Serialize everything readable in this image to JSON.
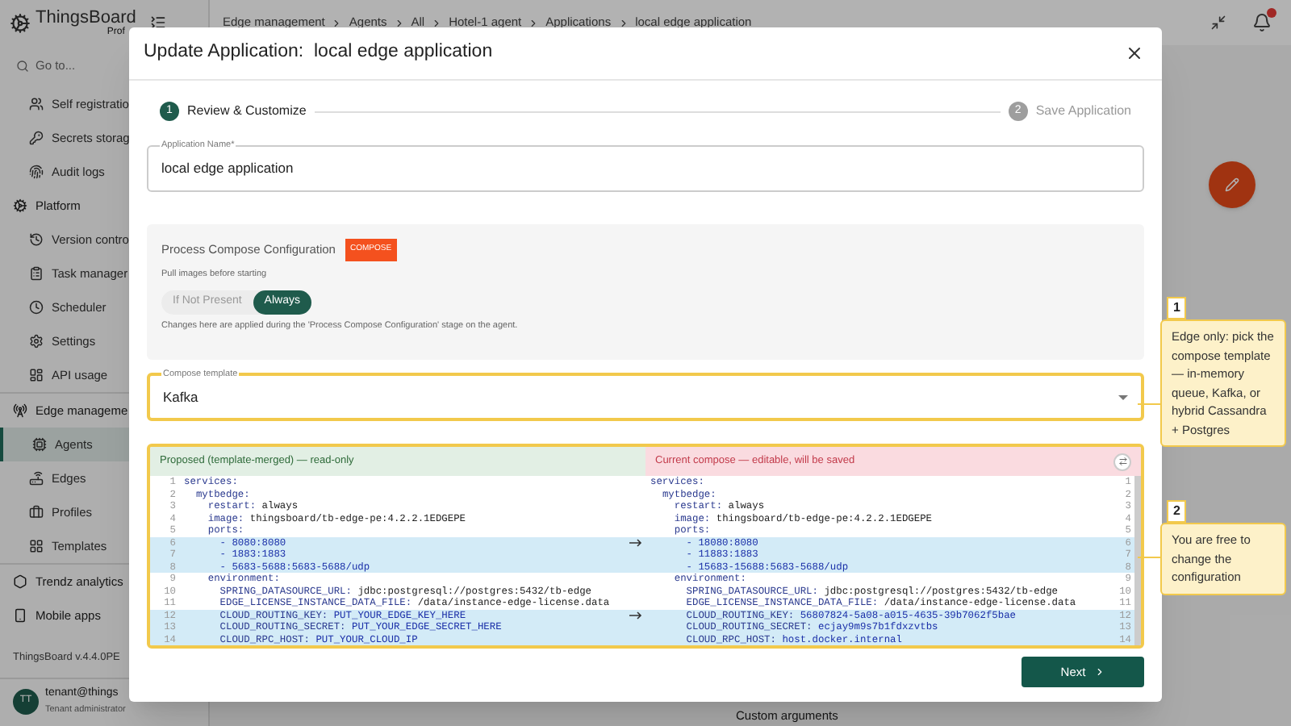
{
  "app": {
    "logo": "ThingsBoard",
    "logo_sub": "Prof",
    "search_placeholder": "Go to...",
    "breadcrumb": [
      "Edge management",
      "Agents",
      "All",
      "Hotel-1 agent",
      "Applications",
      "local edge application"
    ],
    "sidebar": {
      "items": [
        {
          "label": "Self registratio",
          "kind": "item",
          "selected": false
        },
        {
          "label": "Secrets storag",
          "kind": "item",
          "selected": false
        },
        {
          "label": "Audit logs",
          "kind": "item",
          "selected": false
        },
        {
          "label": "Platform",
          "kind": "section",
          "selected": false,
          "children": [
            {
              "label": "Version contro",
              "kind": "item",
              "selected": false
            },
            {
              "label": "Task manager",
              "kind": "item",
              "selected": false
            },
            {
              "label": "Scheduler",
              "kind": "item",
              "selected": false
            },
            {
              "label": "Settings",
              "kind": "item",
              "selected": false
            },
            {
              "label": "API usage",
              "kind": "item",
              "selected": false
            }
          ]
        },
        {
          "label": "Edge manageme",
          "kind": "section",
          "selected": false,
          "children": [
            {
              "label": "Agents",
              "kind": "item",
              "selected": true
            },
            {
              "label": "Edges",
              "kind": "item",
              "selected": false
            },
            {
              "label": "Profiles",
              "kind": "item",
              "selected": false
            },
            {
              "label": "Templates",
              "kind": "item",
              "selected": false
            }
          ]
        },
        {
          "label": "Trendz analytics",
          "kind": "section",
          "selected": false
        },
        {
          "label": "Mobile apps",
          "kind": "section",
          "selected": false
        }
      ]
    },
    "version": "ThingsBoard v.4.4.0PE",
    "user": {
      "initials": "TT",
      "email": "tenant@things",
      "role": "Tenant administrator"
    },
    "background_text": "Custom arguments"
  },
  "dialog": {
    "title": "Update Application:  local edge application",
    "steps": [
      {
        "number": "1",
        "label": "Review & Customize",
        "selected": true
      },
      {
        "number": "2",
        "label": "Save Application",
        "selected": false
      }
    ],
    "name_field": {
      "label": "Application Name*",
      "value": "local edge application"
    },
    "compose_config": {
      "title": "Process Compose Configuration",
      "tag": "COMPOSE",
      "pull_label": "Pull images before starting",
      "options": [
        {
          "label": "If Not Present",
          "selected": false
        },
        {
          "label": "Always",
          "selected": true
        }
      ],
      "note": "Changes here are applied during the 'Process Compose Configuration' stage on the agent."
    },
    "template_field": {
      "label": "Compose template",
      "value": "Kafka",
      "highlighted": true
    },
    "diff": {
      "highlighted": true,
      "proposed": {
        "title": "Proposed (template-merged) — read-only",
        "lines": [
          {
            "num": "1",
            "text": "services:",
            "changed": false
          },
          {
            "num": "2",
            "text": "  mytbedge:",
            "changed": false
          },
          {
            "num": "3",
            "text": "    restart: always",
            "changed": false
          },
          {
            "num": "4",
            "text": "    image: thingsboard/tb-edge-pe:4.2.2.1EDGEPE",
            "changed": false
          },
          {
            "num": "5",
            "text": "    ports:",
            "changed": false
          },
          {
            "num": "6",
            "text": "      - 8080:8080",
            "changed": true
          },
          {
            "num": "7",
            "text": "      - 1883:1883",
            "changed": true
          },
          {
            "num": "8",
            "text": "      - 5683-5688:5683-5688/udp",
            "changed": true
          },
          {
            "num": "9",
            "text": "    environment:",
            "changed": false
          },
          {
            "num": "10",
            "text": "      SPRING_DATASOURCE_URL: jdbc:postgresql://postgres:5432/tb-edge",
            "changed": false
          },
          {
            "num": "11",
            "text": "      EDGE_LICENSE_INSTANCE_DATA_FILE: /data/instance-edge-license.data",
            "changed": false
          },
          {
            "num": "12",
            "text": "      CLOUD_ROUTING_KEY: PUT_YOUR_EDGE_KEY_HERE",
            "changed": true
          },
          {
            "num": "13",
            "text": "      CLOUD_ROUTING_SECRET: PUT_YOUR_EDGE_SECRET_HERE",
            "changed": true
          },
          {
            "num": "14",
            "text": "      CLOUD_RPC_HOST: PUT_YOUR_CLOUD_IP",
            "changed": true
          }
        ]
      },
      "current": {
        "title": "Current compose — editable, will be saved",
        "lines": [
          {
            "num": "1",
            "text": "services:",
            "changed": false
          },
          {
            "num": "2",
            "text": "  mytbedge:",
            "changed": false
          },
          {
            "num": "3",
            "text": "    restart: always",
            "changed": false
          },
          {
            "num": "4",
            "text": "    image: thingsboard/tb-edge-pe:4.2.2.1EDGEPE",
            "changed": false
          },
          {
            "num": "5",
            "text": "    ports:",
            "changed": false
          },
          {
            "num": "6",
            "text": "      - 18080:8080",
            "changed": true
          },
          {
            "num": "7",
            "text": "      - 11883:1883",
            "changed": true
          },
          {
            "num": "8",
            "text": "      - 15683-15688:5683-5688/udp",
            "changed": true
          },
          {
            "num": "9",
            "text": "    environment:",
            "changed": false
          },
          {
            "num": "10",
            "text": "      SPRING_DATASOURCE_URL: jdbc:postgresql://postgres:5432/tb-edge",
            "changed": false
          },
          {
            "num": "11",
            "text": "      EDGE_LICENSE_INSTANCE_DATA_FILE: /data/instance-edge-license.data",
            "changed": false
          },
          {
            "num": "12",
            "text": "      CLOUD_ROUTING_KEY: 56807824-5a08-a015-4635-39b7062f5bae",
            "changed": true
          },
          {
            "num": "13",
            "text": "      CLOUD_ROUTING_SECRET: ecjay9m9s7b1fdxzvtbs",
            "changed": true
          },
          {
            "num": "14",
            "text": "      CLOUD_RPC_HOST: host.docker.internal",
            "changed": true
          }
        ]
      }
    },
    "next_button": "Next"
  },
  "callouts": [
    {
      "number": "1",
      "text": "Edge only: pick the compose template — in-memory queue, Kafka, or hybrid Cassandra + Postgres"
    },
    {
      "number": "2",
      "text": "You are free to change the configuration"
    }
  ]
}
